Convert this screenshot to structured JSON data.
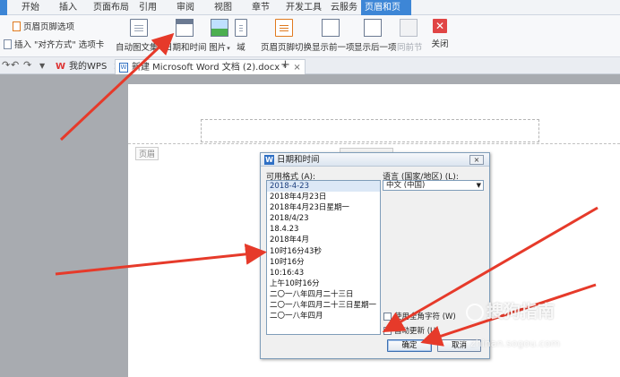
{
  "tabs": [
    "开始",
    "插入",
    "页面布局",
    "引用",
    "审阅",
    "视图",
    "章节",
    "开发工具",
    "云服务",
    "页眉和页脚"
  ],
  "active_tab_index": 9,
  "ribbon": {
    "header_footer_options": "页眉页脚选项",
    "insert_alignment_tab": "插入 \"对齐方式\" 选项卡",
    "insert_picture_text": "图片",
    "items": [
      {
        "label": "自动图文集",
        "caret": "▾"
      },
      {
        "label": "日期和时间"
      },
      {
        "label": "图片",
        "caret": "▾"
      },
      {
        "label": "域"
      },
      {
        "label": "页眉页脚切换"
      },
      {
        "label": "显示前一项"
      },
      {
        "label": "显示后一项"
      },
      {
        "label": "同前节"
      },
      {
        "label": "关闭"
      }
    ]
  },
  "doc_tabs": {
    "wps_home": "我的WPS",
    "document": "新建 Microsoft Word 文档 (2).docx *",
    "close": "×",
    "new_tab": "+"
  },
  "page": {
    "header_label": "页眉"
  },
  "dialog": {
    "title": "日期和时间",
    "close": "×",
    "formats_label": "可用格式 (A):",
    "language_label": "语言 (国家/地区) (L):",
    "language_value": "中文 (中国)",
    "formats": [
      "2018-4-23",
      "2018年4月23日",
      "2018年4月23日星期一",
      "2018/4/23",
      "18.4.23",
      "2018年4月",
      "10时16分43秒",
      "10时16分",
      "10:16:43",
      "上午10时16分",
      "二〇一八年四月二十三日",
      "二〇一八年四月二十三日星期一",
      "二〇一八年四月"
    ],
    "selected_index": 0,
    "fullwidth_checkbox": "使用全角字符 (W)",
    "autoupdate_checkbox": "自动更新 (U)",
    "ok": "确定",
    "cancel": "取消"
  },
  "watermark": {
    "brand": "搜狗指南",
    "url": "zhinan.sogou.com"
  },
  "colors": {
    "accent_tab": "#3d86d6",
    "annotation_arrow": "#e63a2a"
  }
}
